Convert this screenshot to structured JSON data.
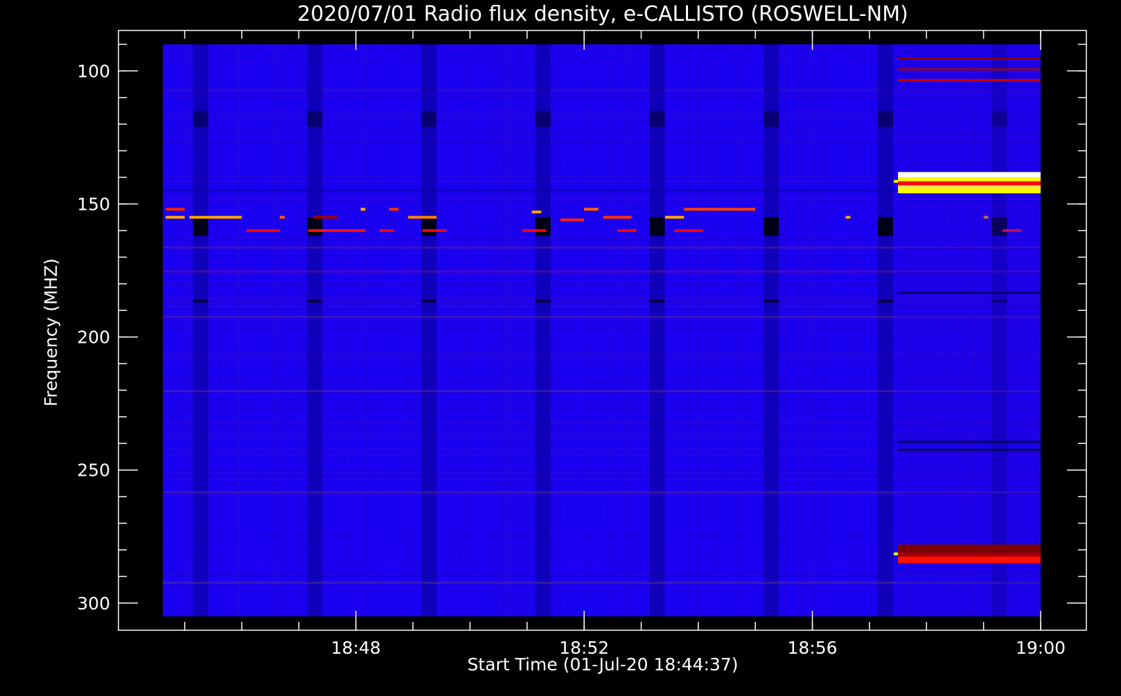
{
  "chart_data": {
    "type": "heatmap",
    "title": "2020/07/01  Radio flux density, e-CALLISTO (ROSWELL-NM)",
    "xlabel": "Start Time (01-Jul-20 18:44:37)",
    "ylabel": "Frequency (MHZ)",
    "x_axis": {
      "unit": "time",
      "range": [
        "18:44:37",
        "19:00:00"
      ],
      "major_ticks": [
        "18:48",
        "18:52",
        "18:56",
        "19:00"
      ]
    },
    "y_axis": {
      "unit": "MHz",
      "range": [
        305,
        90
      ],
      "inverted": true,
      "major_ticks": [
        100,
        150,
        200,
        250,
        300
      ]
    },
    "colormap": [
      "#00008b",
      "#0000ff",
      "#8b0000",
      "#ff0000",
      "#ffa500",
      "#ffff00",
      "#ffffff"
    ],
    "background_level": "blue",
    "dark_gap_times": [
      "18:45:16",
      "18:47:16",
      "18:49:16",
      "18:51:16",
      "18:53:16",
      "18:55:16",
      "18:57:16",
      "18:59:16"
    ],
    "features": [
      {
        "description_time_start": "18:57:30",
        "time_end": "19:00:00",
        "freq_low": 138,
        "freq_high": 146,
        "intensity": "high"
      },
      {
        "description_time_start": "18:57:30",
        "time_end": "19:00:00",
        "freq_low": 278,
        "freq_high": 285,
        "intensity": "medium"
      },
      {
        "description_time_start": "18:44:37",
        "time_end": "18:53:30",
        "freq_low": 151,
        "freq_high": 160,
        "intensity": "intermittent"
      }
    ]
  }
}
